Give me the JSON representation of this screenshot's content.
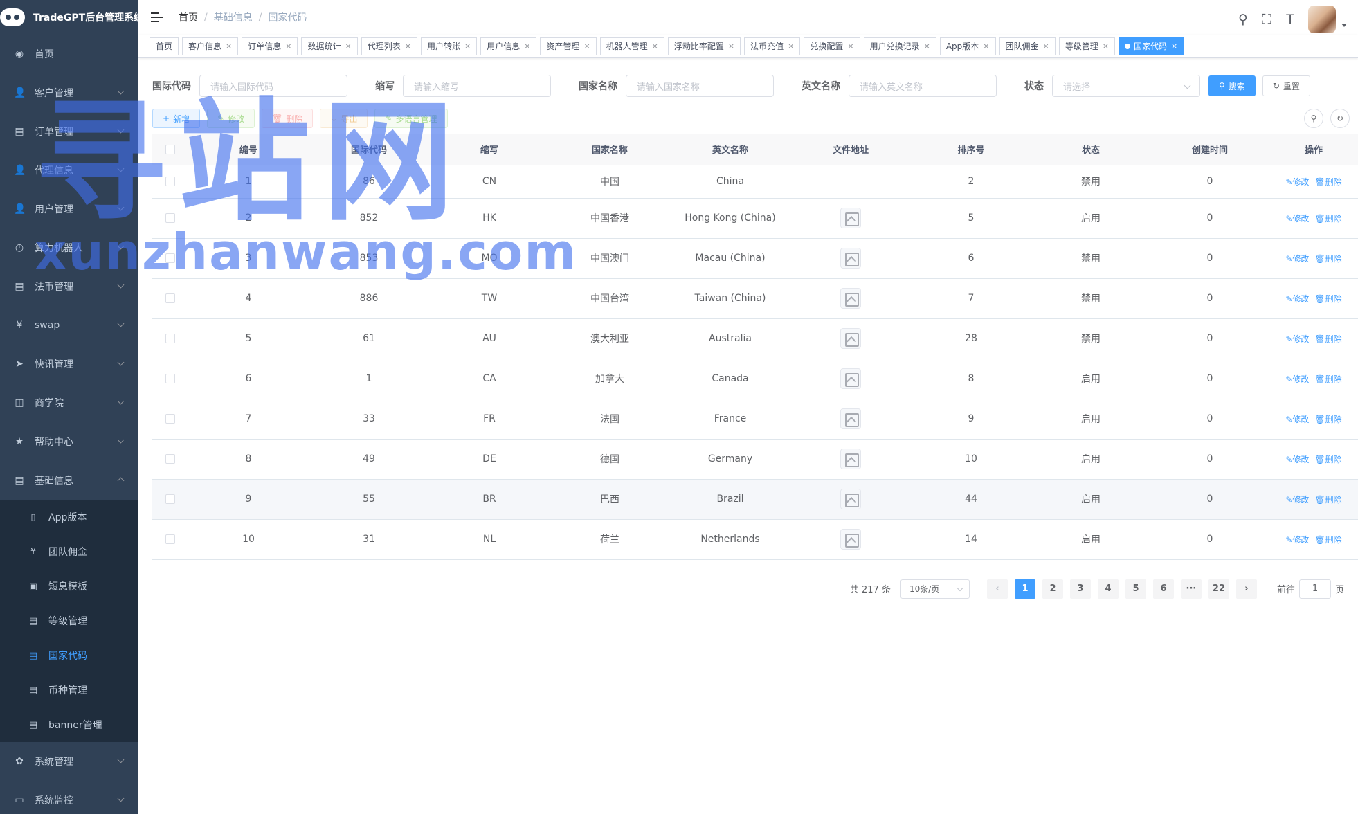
{
  "app": {
    "title": "TradeGPT后台管理系统"
  },
  "sidebar": {
    "items": [
      {
        "label": "首页",
        "icon": "dashboard-icon",
        "glyph": "◉",
        "arrow": false
      },
      {
        "label": "客户管理",
        "icon": "user-icon",
        "glyph": "👤",
        "arrow": true
      },
      {
        "label": "订单管理",
        "icon": "document-icon",
        "glyph": "▤",
        "arrow": true
      },
      {
        "label": "代理信息",
        "icon": "user-icon",
        "glyph": "👤",
        "arrow": true
      },
      {
        "label": "用户管理",
        "icon": "user-icon",
        "glyph": "👤",
        "arrow": true
      },
      {
        "label": "算力机器人",
        "icon": "clock-icon",
        "glyph": "◷",
        "arrow": true
      },
      {
        "label": "法币管理",
        "icon": "document-icon",
        "glyph": "▤",
        "arrow": true
      },
      {
        "label": "swap",
        "icon": "yen-icon",
        "glyph": "¥",
        "arrow": true
      },
      {
        "label": "快讯管理",
        "icon": "send-icon",
        "glyph": "➤",
        "arrow": true
      },
      {
        "label": "商学院",
        "icon": "book-icon",
        "glyph": "◫",
        "arrow": true
      },
      {
        "label": "帮助中心",
        "icon": "star-icon",
        "glyph": "★",
        "arrow": true
      },
      {
        "label": "基础信息",
        "icon": "document-icon",
        "glyph": "▤",
        "arrow": true,
        "open": true
      }
    ],
    "sub_items": [
      {
        "label": "App版本",
        "icon": "phone-icon",
        "glyph": "▯"
      },
      {
        "label": "团队佣金",
        "icon": "yen-icon",
        "glyph": "¥"
      },
      {
        "label": "短息模板",
        "icon": "message-icon",
        "glyph": "▣"
      },
      {
        "label": "等级管理",
        "icon": "document-icon",
        "glyph": "▤"
      },
      {
        "label": "国家代码",
        "icon": "document-icon",
        "glyph": "▤",
        "active": true
      },
      {
        "label": "币种管理",
        "icon": "document-icon",
        "glyph": "▤"
      },
      {
        "label": "banner管理",
        "icon": "document-icon",
        "glyph": "▤"
      }
    ],
    "bottom_items": [
      {
        "label": "系统管理",
        "icon": "gear-icon",
        "glyph": "✿"
      },
      {
        "label": "系统监控",
        "icon": "monitor-icon",
        "glyph": "▭"
      }
    ]
  },
  "breadcrumb": [
    "首页",
    "基础信息",
    "国家代码"
  ],
  "tags": [
    {
      "label": "首页",
      "closable": false
    },
    {
      "label": "客户信息",
      "closable": true
    },
    {
      "label": "订单信息",
      "closable": true
    },
    {
      "label": "数据统计",
      "closable": true
    },
    {
      "label": "代理列表",
      "closable": true
    },
    {
      "label": "用户转账",
      "closable": true
    },
    {
      "label": "用户信息",
      "closable": true
    },
    {
      "label": "资产管理",
      "closable": true
    },
    {
      "label": "机器人管理",
      "closable": true
    },
    {
      "label": "浮动比率配置",
      "closable": true
    },
    {
      "label": "法币充值",
      "closable": true
    },
    {
      "label": "兑换配置",
      "closable": true
    },
    {
      "label": "用户兑换记录",
      "closable": true
    },
    {
      "label": "App版本",
      "closable": true
    },
    {
      "label": "团队佣金",
      "closable": true
    },
    {
      "label": "等级管理",
      "closable": true
    },
    {
      "label": "国家代码",
      "closable": true,
      "active": true
    }
  ],
  "search": {
    "fields": [
      {
        "label": "国际代码",
        "placeholder": "请输入国际代码"
      },
      {
        "label": "缩写",
        "placeholder": "请输入缩写"
      },
      {
        "label": "国家名称",
        "placeholder": "请输入国家名称"
      },
      {
        "label": "英文名称",
        "placeholder": "请输入英文名称"
      }
    ],
    "status_label": "状态",
    "status_placeholder": "请选择",
    "search_button": "搜索",
    "reset_button": "重置"
  },
  "toolbar": {
    "add": "新增",
    "edit": "修改",
    "delete": "删除",
    "export": "导出",
    "multilang": "多语言管理"
  },
  "table": {
    "headers": [
      "编号",
      "国际代码",
      "缩写",
      "国家名称",
      "英文名称",
      "文件地址",
      "排序号",
      "状态",
      "创建时间",
      "操作"
    ],
    "edit_label": "修改",
    "delete_label": "删除",
    "rows": [
      {
        "id": "1",
        "code": "86",
        "abbr": "CN",
        "name": "中国",
        "en": "China",
        "has_image": false,
        "sort": "2",
        "status": "禁用",
        "created": "0"
      },
      {
        "id": "2",
        "code": "852",
        "abbr": "HK",
        "name": "中国香港",
        "en": "Hong Kong (China)",
        "has_image": true,
        "sort": "5",
        "status": "启用",
        "created": "0"
      },
      {
        "id": "3",
        "code": "853",
        "abbr": "MO",
        "name": "中国澳门",
        "en": "Macau (China)",
        "has_image": true,
        "sort": "6",
        "status": "禁用",
        "created": "0"
      },
      {
        "id": "4",
        "code": "886",
        "abbr": "TW",
        "name": "中国台湾",
        "en": "Taiwan (China)",
        "has_image": true,
        "sort": "7",
        "status": "禁用",
        "created": "0"
      },
      {
        "id": "5",
        "code": "61",
        "abbr": "AU",
        "name": "澳大利亚",
        "en": "Australia",
        "has_image": true,
        "sort": "28",
        "status": "禁用",
        "created": "0"
      },
      {
        "id": "6",
        "code": "1",
        "abbr": "CA",
        "name": "加拿大",
        "en": "Canada",
        "has_image": true,
        "sort": "8",
        "status": "启用",
        "created": "0"
      },
      {
        "id": "7",
        "code": "33",
        "abbr": "FR",
        "name": "法国",
        "en": "France",
        "has_image": true,
        "sort": "9",
        "status": "启用",
        "created": "0"
      },
      {
        "id": "8",
        "code": "49",
        "abbr": "DE",
        "name": "德国",
        "en": "Germany",
        "has_image": true,
        "sort": "10",
        "status": "启用",
        "created": "0"
      },
      {
        "id": "9",
        "code": "55",
        "abbr": "BR",
        "name": "巴西",
        "en": "Brazil",
        "has_image": true,
        "sort": "44",
        "status": "启用",
        "created": "0",
        "hover": true
      },
      {
        "id": "10",
        "code": "31",
        "abbr": "NL",
        "name": "荷兰",
        "en": "Netherlands",
        "has_image": true,
        "sort": "14",
        "status": "启用",
        "created": "0"
      }
    ]
  },
  "pagination": {
    "total_text": "共 217 条",
    "page_size": "10条/页",
    "pages": [
      "1",
      "2",
      "3",
      "4",
      "5",
      "6",
      "···",
      "22"
    ],
    "current": "1",
    "goto_prefix": "前往",
    "goto_value": "1",
    "goto_suffix": "页"
  },
  "watermark": {
    "line1": "寻站网",
    "line2": "xunzhanwang.com"
  }
}
